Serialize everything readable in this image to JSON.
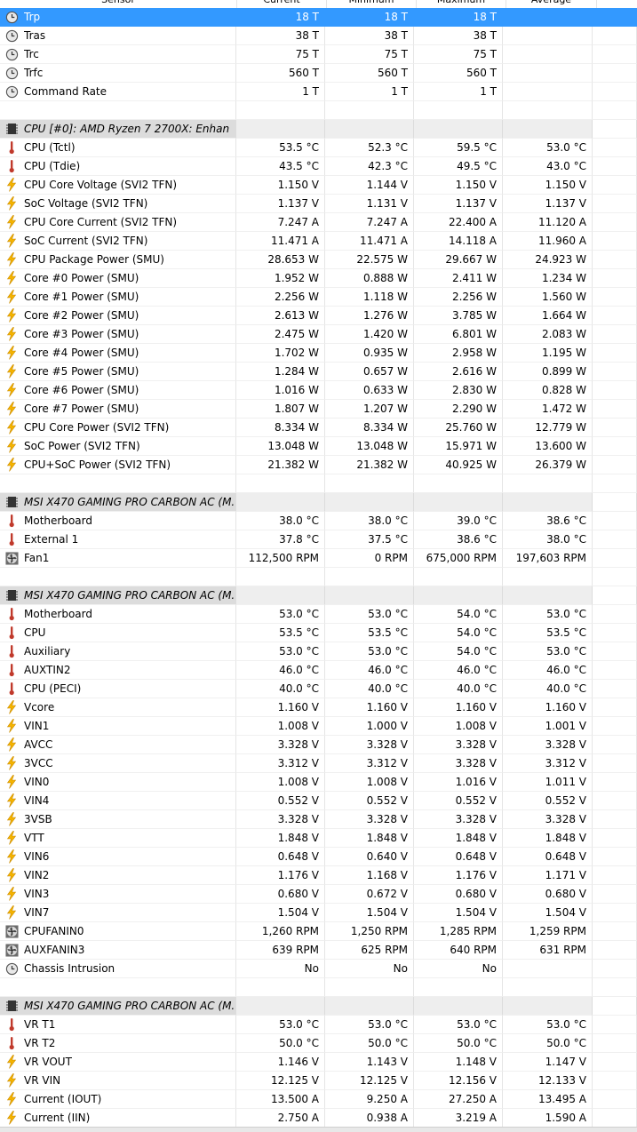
{
  "columns": [
    "Sensor",
    "Current",
    "Minimum",
    "Maximum",
    "Average"
  ],
  "rows": [
    {
      "kind": "sensor",
      "icon": "clock-icon",
      "name": "Trp",
      "cur": "18 T",
      "min": "18 T",
      "max": "18 T",
      "avg": "",
      "selected": true
    },
    {
      "kind": "sensor",
      "icon": "clock-icon",
      "name": "Tras",
      "cur": "38 T",
      "min": "38 T",
      "max": "38 T",
      "avg": ""
    },
    {
      "kind": "sensor",
      "icon": "clock-icon",
      "name": "Trc",
      "cur": "75 T",
      "min": "75 T",
      "max": "75 T",
      "avg": ""
    },
    {
      "kind": "sensor",
      "icon": "clock-icon",
      "name": "Trfc",
      "cur": "560 T",
      "min": "560 T",
      "max": "560 T",
      "avg": ""
    },
    {
      "kind": "sensor",
      "icon": "clock-icon",
      "name": "Command Rate",
      "cur": "1 T",
      "min": "1 T",
      "max": "1 T",
      "avg": ""
    },
    {
      "kind": "spacer"
    },
    {
      "kind": "group",
      "name": "CPU [#0]: AMD Ryzen 7 2700X: Enhan"
    },
    {
      "kind": "sensor",
      "icon": "thermometer-icon",
      "name": "CPU (Tctl)",
      "cur": "53.5 °C",
      "min": "52.3 °C",
      "max": "59.5 °C",
      "avg": "53.0 °C"
    },
    {
      "kind": "sensor",
      "icon": "thermometer-icon",
      "name": "CPU (Tdie)",
      "cur": "43.5 °C",
      "min": "42.3 °C",
      "max": "49.5 °C",
      "avg": "43.0 °C"
    },
    {
      "kind": "sensor",
      "icon": "lightning-icon",
      "name": "CPU Core Voltage (SVI2 TFN)",
      "cur": "1.150 V",
      "min": "1.144 V",
      "max": "1.150 V",
      "avg": "1.150 V"
    },
    {
      "kind": "sensor",
      "icon": "lightning-icon",
      "name": "SoC Voltage (SVI2 TFN)",
      "cur": "1.137 V",
      "min": "1.131 V",
      "max": "1.137 V",
      "avg": "1.137 V"
    },
    {
      "kind": "sensor",
      "icon": "lightning-icon",
      "name": "CPU Core Current (SVI2 TFN)",
      "cur": "7.247 A",
      "min": "7.247 A",
      "max": "22.400 A",
      "avg": "11.120 A"
    },
    {
      "kind": "sensor",
      "icon": "lightning-icon",
      "name": "SoC Current (SVI2 TFN)",
      "cur": "11.471 A",
      "min": "11.471 A",
      "max": "14.118 A",
      "avg": "11.960 A"
    },
    {
      "kind": "sensor",
      "icon": "lightning-icon",
      "name": "CPU Package Power (SMU)",
      "cur": "28.653 W",
      "min": "22.575 W",
      "max": "29.667 W",
      "avg": "24.923 W"
    },
    {
      "kind": "sensor",
      "icon": "lightning-icon",
      "name": "Core #0 Power (SMU)",
      "cur": "1.952 W",
      "min": "0.888 W",
      "max": "2.411 W",
      "avg": "1.234 W"
    },
    {
      "kind": "sensor",
      "icon": "lightning-icon",
      "name": "Core #1 Power (SMU)",
      "cur": "2.256 W",
      "min": "1.118 W",
      "max": "2.256 W",
      "avg": "1.560 W"
    },
    {
      "kind": "sensor",
      "icon": "lightning-icon",
      "name": "Core #2 Power (SMU)",
      "cur": "2.613 W",
      "min": "1.276 W",
      "max": "3.785 W",
      "avg": "1.664 W"
    },
    {
      "kind": "sensor",
      "icon": "lightning-icon",
      "name": "Core #3 Power (SMU)",
      "cur": "2.475 W",
      "min": "1.420 W",
      "max": "6.801 W",
      "avg": "2.083 W"
    },
    {
      "kind": "sensor",
      "icon": "lightning-icon",
      "name": "Core #4 Power (SMU)",
      "cur": "1.702 W",
      "min": "0.935 W",
      "max": "2.958 W",
      "avg": "1.195 W"
    },
    {
      "kind": "sensor",
      "icon": "lightning-icon",
      "name": "Core #5 Power (SMU)",
      "cur": "1.284 W",
      "min": "0.657 W",
      "max": "2.616 W",
      "avg": "0.899 W"
    },
    {
      "kind": "sensor",
      "icon": "lightning-icon",
      "name": "Core #6 Power (SMU)",
      "cur": "1.016 W",
      "min": "0.633 W",
      "max": "2.830 W",
      "avg": "0.828 W"
    },
    {
      "kind": "sensor",
      "icon": "lightning-icon",
      "name": "Core #7 Power (SMU)",
      "cur": "1.807 W",
      "min": "1.207 W",
      "max": "2.290 W",
      "avg": "1.472 W"
    },
    {
      "kind": "sensor",
      "icon": "lightning-icon",
      "name": "CPU Core Power (SVI2 TFN)",
      "cur": "8.334 W",
      "min": "8.334 W",
      "max": "25.760 W",
      "avg": "12.779 W"
    },
    {
      "kind": "sensor",
      "icon": "lightning-icon",
      "name": "SoC Power (SVI2 TFN)",
      "cur": "13.048 W",
      "min": "13.048 W",
      "max": "15.971 W",
      "avg": "13.600 W"
    },
    {
      "kind": "sensor",
      "icon": "lightning-icon",
      "name": "CPU+SoC Power (SVI2 TFN)",
      "cur": "21.382 W",
      "min": "21.382 W",
      "max": "40.925 W",
      "avg": "26.379 W"
    },
    {
      "kind": "spacer"
    },
    {
      "kind": "group",
      "name": "MSI X470 GAMING PRO CARBON AC (M..."
    },
    {
      "kind": "sensor",
      "icon": "thermometer-icon",
      "name": "Motherboard",
      "cur": "38.0 °C",
      "min": "38.0 °C",
      "max": "39.0 °C",
      "avg": "38.6 °C"
    },
    {
      "kind": "sensor",
      "icon": "thermometer-icon",
      "name": "External 1",
      "cur": "37.8 °C",
      "min": "37.5 °C",
      "max": "38.6 °C",
      "avg": "38.0 °C"
    },
    {
      "kind": "sensor",
      "icon": "fan-icon",
      "name": "Fan1",
      "cur": "112,500 RPM",
      "min": "0 RPM",
      "max": "675,000 RPM",
      "avg": "197,603 RPM"
    },
    {
      "kind": "spacer"
    },
    {
      "kind": "group",
      "name": "MSI X470 GAMING PRO CARBON AC (M..."
    },
    {
      "kind": "sensor",
      "icon": "thermometer-icon",
      "name": "Motherboard",
      "cur": "53.0 °C",
      "min": "53.0 °C",
      "max": "54.0 °C",
      "avg": "53.0 °C"
    },
    {
      "kind": "sensor",
      "icon": "thermometer-icon",
      "name": "CPU",
      "cur": "53.5 °C",
      "min": "53.5 °C",
      "max": "54.0 °C",
      "avg": "53.5 °C"
    },
    {
      "kind": "sensor",
      "icon": "thermometer-icon",
      "name": "Auxiliary",
      "cur": "53.0 °C",
      "min": "53.0 °C",
      "max": "54.0 °C",
      "avg": "53.0 °C"
    },
    {
      "kind": "sensor",
      "icon": "thermometer-icon",
      "name": "AUXTIN2",
      "cur": "46.0 °C",
      "min": "46.0 °C",
      "max": "46.0 °C",
      "avg": "46.0 °C"
    },
    {
      "kind": "sensor",
      "icon": "thermometer-icon",
      "name": "CPU (PECI)",
      "cur": "40.0 °C",
      "min": "40.0 °C",
      "max": "40.0 °C",
      "avg": "40.0 °C"
    },
    {
      "kind": "sensor",
      "icon": "lightning-icon",
      "name": "Vcore",
      "cur": "1.160 V",
      "min": "1.160 V",
      "max": "1.160 V",
      "avg": "1.160 V"
    },
    {
      "kind": "sensor",
      "icon": "lightning-icon",
      "name": "VIN1",
      "cur": "1.008 V",
      "min": "1.000 V",
      "max": "1.008 V",
      "avg": "1.001 V"
    },
    {
      "kind": "sensor",
      "icon": "lightning-icon",
      "name": "AVCC",
      "cur": "3.328 V",
      "min": "3.328 V",
      "max": "3.328 V",
      "avg": "3.328 V"
    },
    {
      "kind": "sensor",
      "icon": "lightning-icon",
      "name": "3VCC",
      "cur": "3.312 V",
      "min": "3.312 V",
      "max": "3.328 V",
      "avg": "3.312 V"
    },
    {
      "kind": "sensor",
      "icon": "lightning-icon",
      "name": "VIN0",
      "cur": "1.008 V",
      "min": "1.008 V",
      "max": "1.016 V",
      "avg": "1.011 V"
    },
    {
      "kind": "sensor",
      "icon": "lightning-icon",
      "name": "VIN4",
      "cur": "0.552 V",
      "min": "0.552 V",
      "max": "0.552 V",
      "avg": "0.552 V"
    },
    {
      "kind": "sensor",
      "icon": "lightning-icon",
      "name": "3VSB",
      "cur": "3.328 V",
      "min": "3.328 V",
      "max": "3.328 V",
      "avg": "3.328 V"
    },
    {
      "kind": "sensor",
      "icon": "lightning-icon",
      "name": "VTT",
      "cur": "1.848 V",
      "min": "1.848 V",
      "max": "1.848 V",
      "avg": "1.848 V"
    },
    {
      "kind": "sensor",
      "icon": "lightning-icon",
      "name": "VIN6",
      "cur": "0.648 V",
      "min": "0.640 V",
      "max": "0.648 V",
      "avg": "0.648 V"
    },
    {
      "kind": "sensor",
      "icon": "lightning-icon",
      "name": "VIN2",
      "cur": "1.176 V",
      "min": "1.168 V",
      "max": "1.176 V",
      "avg": "1.171 V"
    },
    {
      "kind": "sensor",
      "icon": "lightning-icon",
      "name": "VIN3",
      "cur": "0.680 V",
      "min": "0.672 V",
      "max": "0.680 V",
      "avg": "0.680 V"
    },
    {
      "kind": "sensor",
      "icon": "lightning-icon",
      "name": "VIN7",
      "cur": "1.504 V",
      "min": "1.504 V",
      "max": "1.504 V",
      "avg": "1.504 V"
    },
    {
      "kind": "sensor",
      "icon": "fan-icon",
      "name": "CPUFANIN0",
      "cur": "1,260 RPM",
      "min": "1,250 RPM",
      "max": "1,285 RPM",
      "avg": "1,259 RPM"
    },
    {
      "kind": "sensor",
      "icon": "fan-icon",
      "name": "AUXFANIN3",
      "cur": "639 RPM",
      "min": "625 RPM",
      "max": "640 RPM",
      "avg": "631 RPM"
    },
    {
      "kind": "sensor",
      "icon": "clock-icon",
      "name": "Chassis Intrusion",
      "cur": "No",
      "min": "No",
      "max": "No",
      "avg": ""
    },
    {
      "kind": "spacer"
    },
    {
      "kind": "group",
      "name": "MSI X470 GAMING PRO CARBON AC (M..."
    },
    {
      "kind": "sensor",
      "icon": "thermometer-icon",
      "name": "VR T1",
      "cur": "53.0 °C",
      "min": "53.0 °C",
      "max": "53.0 °C",
      "avg": "53.0 °C"
    },
    {
      "kind": "sensor",
      "icon": "thermometer-icon",
      "name": "VR T2",
      "cur": "50.0 °C",
      "min": "50.0 °C",
      "max": "50.0 °C",
      "avg": "50.0 °C"
    },
    {
      "kind": "sensor",
      "icon": "lightning-icon",
      "name": "VR VOUT",
      "cur": "1.146 V",
      "min": "1.143 V",
      "max": "1.148 V",
      "avg": "1.147 V"
    },
    {
      "kind": "sensor",
      "icon": "lightning-icon",
      "name": "VR VIN",
      "cur": "12.125 V",
      "min": "12.125 V",
      "max": "12.156 V",
      "avg": "12.133 V"
    },
    {
      "kind": "sensor",
      "icon": "lightning-icon",
      "name": "Current (IOUT)",
      "cur": "13.500 A",
      "min": "9.250 A",
      "max": "27.250 A",
      "avg": "13.495 A"
    },
    {
      "kind": "sensor",
      "icon": "lightning-icon",
      "name": "Current (IIN)",
      "cur": "2.750 A",
      "min": "0.938 A",
      "max": "3.219 A",
      "avg": "1.590 A"
    }
  ]
}
